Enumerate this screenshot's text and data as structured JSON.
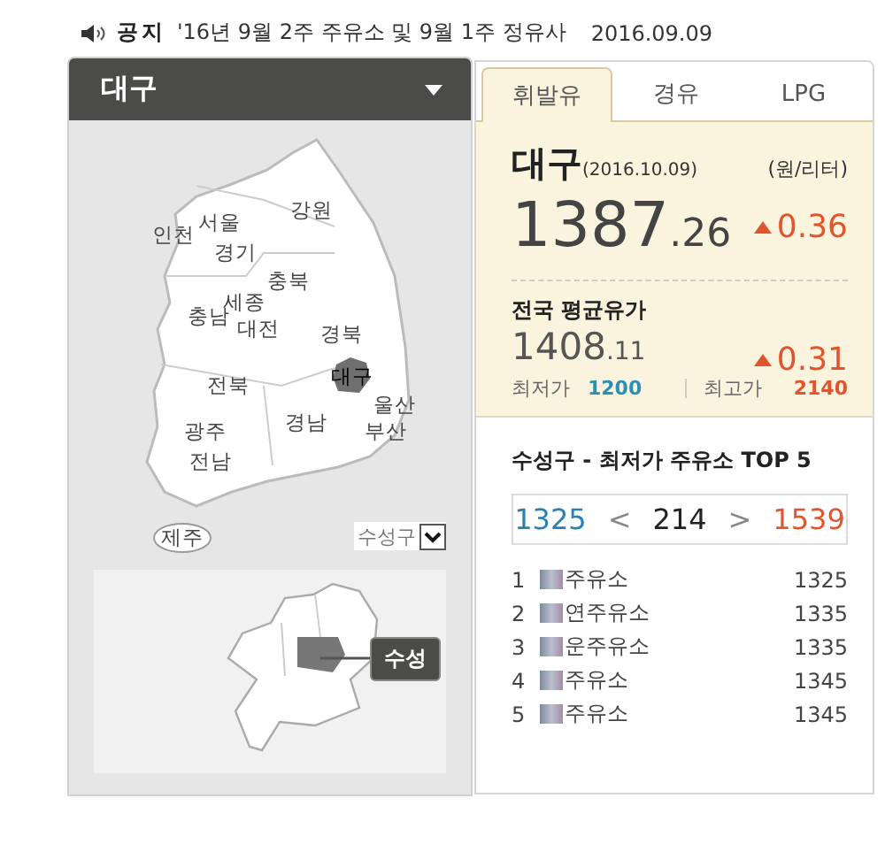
{
  "notice": {
    "label": "공지",
    "text": "'16년 9월 2주 주유소 및 9월 1주 정유사",
    "date": "2016.09.09"
  },
  "region_panel": {
    "title": "대구",
    "regions": [
      {
        "label": "인천",
        "selected": false
      },
      {
        "label": "서울",
        "selected": false
      },
      {
        "label": "강원",
        "selected": false
      },
      {
        "label": "경기",
        "selected": false
      },
      {
        "label": "충북",
        "selected": false
      },
      {
        "label": "충남",
        "selected": false
      },
      {
        "label": "세종",
        "selected": false
      },
      {
        "label": "대전",
        "selected": false
      },
      {
        "label": "경북",
        "selected": false
      },
      {
        "label": "전북",
        "selected": false
      },
      {
        "label": "대구",
        "selected": true
      },
      {
        "label": "광주",
        "selected": false
      },
      {
        "label": "경남",
        "selected": false
      },
      {
        "label": "울산",
        "selected": false
      },
      {
        "label": "부산",
        "selected": false
      },
      {
        "label": "전남",
        "selected": false
      },
      {
        "label": "제주",
        "selected": false
      }
    ],
    "district_select": {
      "value": "수성구"
    },
    "district_label": "수성"
  },
  "price_panel": {
    "tabs": [
      {
        "label": "휘발유",
        "selected": true
      },
      {
        "label": "경유",
        "selected": false
      },
      {
        "label": "LPG",
        "selected": false
      }
    ],
    "region": "대구",
    "date": "(2016.10.09)",
    "unit": "(원/리터)",
    "price": "1387.26",
    "change": "0.36",
    "rising": true,
    "national": {
      "title": "전국 평균유가",
      "price": "1408.11",
      "change": "0.31",
      "rising": true,
      "min_label": "최저가",
      "min": "1200",
      "max_label": "최고가",
      "max": "2140"
    }
  },
  "top_stations": {
    "title": "수성구 - 최저가 주유소 TOP 5",
    "low": "1325",
    "prev": "<",
    "count": "214",
    "next": ">",
    "high": "1539",
    "rows": [
      {
        "rank": "1",
        "name": "주유소",
        "price": "1325"
      },
      {
        "rank": "2",
        "name": "연주유소",
        "price": "1335"
      },
      {
        "rank": "3",
        "name": "운주유소",
        "price": "1335"
      },
      {
        "rank": "4",
        "name": "주유소",
        "price": "1345"
      },
      {
        "rank": "5",
        "name": "주유소",
        "price": "1345"
      }
    ]
  }
}
